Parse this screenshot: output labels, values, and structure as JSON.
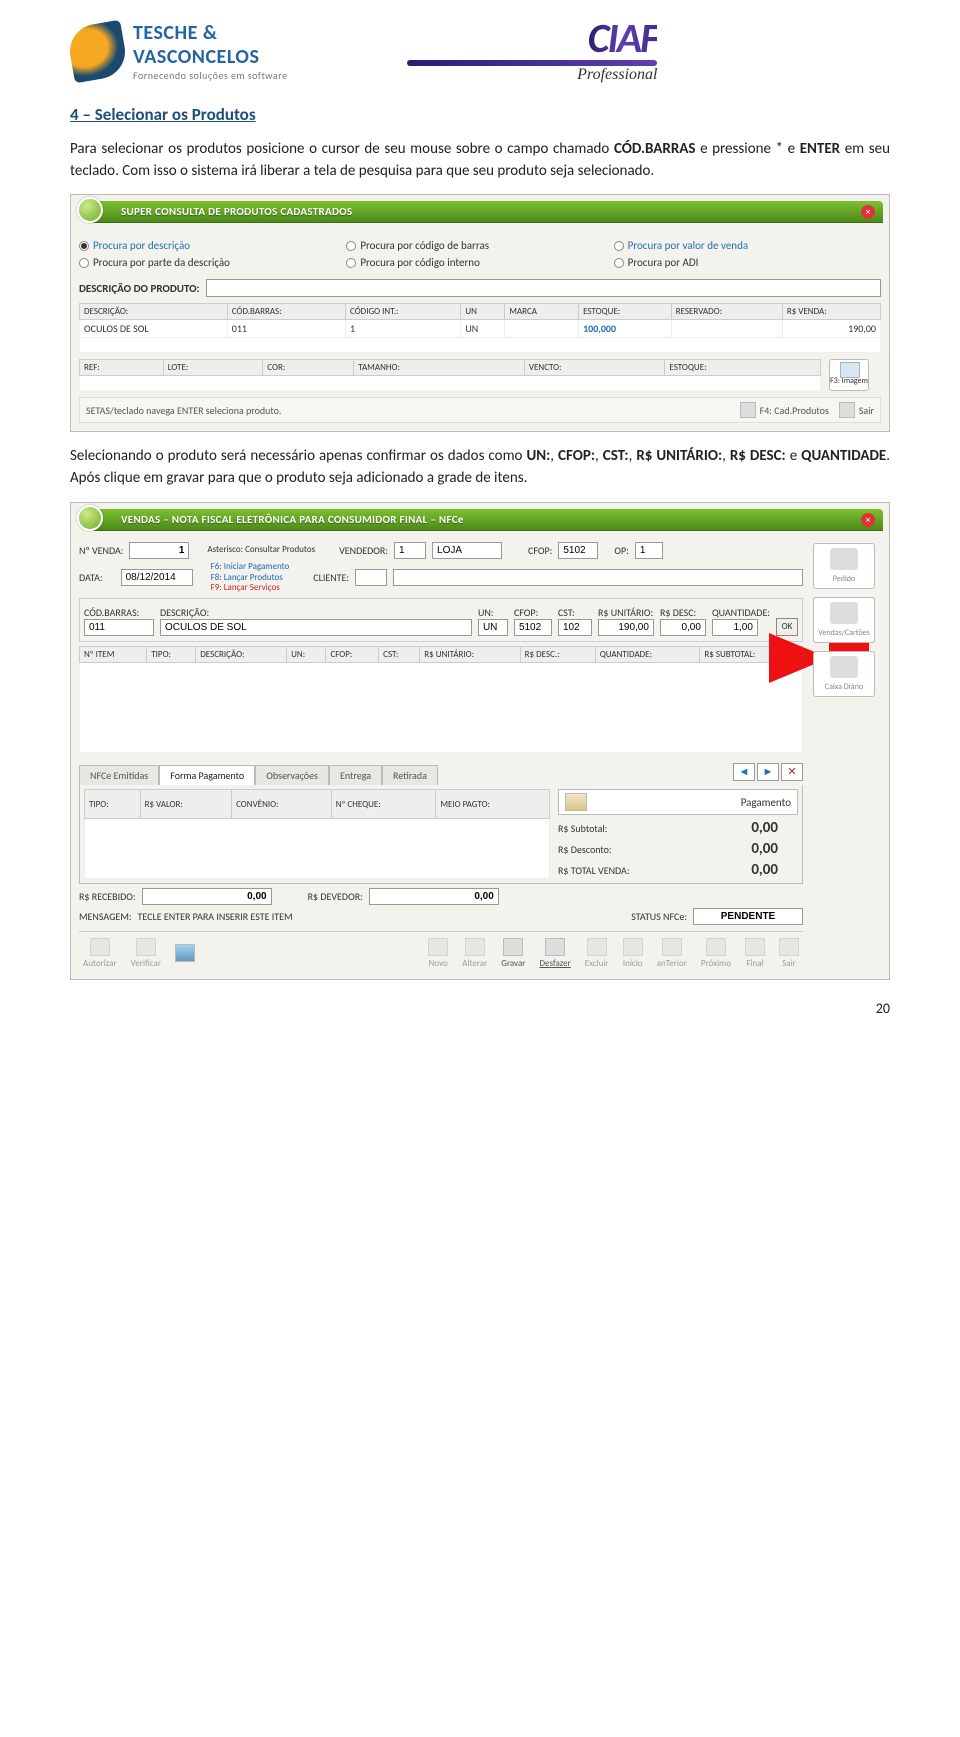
{
  "logos": {
    "tv_name": "TESCHE &",
    "tv_name2": "VASCONCELOS",
    "tv_tagline": "Fornecendo soluções em software",
    "ciaf": "CIAF",
    "ciaf_sub": "Professional"
  },
  "section_title": "4 – Selecionar os Produtos",
  "para1_a": "Para selecionar os produtos posicione o cursor de seu mouse sobre o campo chamado ",
  "para1_b": "CÓD.BARRAS",
  "para1_c": " e pressione * e ",
  "para1_d": "ENTER",
  "para1_e": " em seu teclado. Com isso o sistema irá liberar a tela de pesquisa para que seu produto seja selecionado.",
  "shot1": {
    "title": "SUPER CONSULTA DE PRODUTOS CADASTRADOS",
    "radios_col1": [
      "Procura por descrição",
      "Procura por parte da descrição"
    ],
    "radios_col2": [
      "Procura por código de barras",
      "Procura por código interno"
    ],
    "radios_col3": [
      "Procura por valor de venda",
      "Procura por ADI"
    ],
    "desc_label": "DESCRIÇÃO DO PRODUTO:",
    "headers": [
      "DESCRIÇÃO:",
      "CÓD.BARRAS:",
      "CÓDIGO INT.:",
      "UN",
      "MARCA",
      "ESTOQUE:",
      "RESERVADO:",
      "R$ VENDA:"
    ],
    "row": [
      "OCULOS DE SOL",
      "011",
      "1",
      "UN",
      "",
      "100,000",
      "",
      "190,00"
    ],
    "headers2": [
      "REF:",
      "LOTE:",
      "COR:",
      "TAMANHO:",
      "VENCTO:",
      "ESTOQUE:"
    ],
    "hint": "SETAS/teclado navega   ENTER seleciona produto.",
    "side_imagem": "F3: Imagem",
    "side_cad": "F4: Cad.Produtos",
    "side_sair": "Sair"
  },
  "para2_a": "Selecionando o produto será necessário apenas confirmar os dados como ",
  "para2_b": "UN:",
  "para2_c": ", ",
  "para2_d": "CFOP:",
  "para2_e": ", ",
  "para2_f": "CST:",
  "para2_g": ", ",
  "para2_h": "R$ UNITÁRIO:",
  "para2_i": ", ",
  "para2_j": "R$ DESC:",
  "para2_k": " e ",
  "para2_l": "QUANTIDADE",
  "para2_m": ". Após clique em gravar para que o produto seja adicionado a grade de itens.",
  "shot2": {
    "title": "VENDAS – NOTA FISCAL ELETRÔNICA PARA CONSUMIDOR FINAL – NFCe",
    "labels": {
      "n_venda": "Nº VENDA:",
      "n_venda_v": "1",
      "data": "DATA:",
      "data_v": "08/12/2014",
      "shortcuts_top": "Asterisco: Consultar Produtos",
      "shortcuts": [
        "F6: Iniciar Pagamento",
        "F8: Lançar Produtos",
        "F9: Lançar Serviços"
      ],
      "vendedor": "VENDEDOR:",
      "vendedor_v": "1",
      "loja": "LOJA",
      "cfop_top": "CFOP:",
      "cfop_top_v": "5102",
      "op": "OP:",
      "op_v": "1",
      "cliente": "CLIENTE:",
      "cod_barras": "CÓD.BARRAS:",
      "cod_barras_v": "011",
      "descricao": "DESCRIÇÃO:",
      "descricao_v": "OCULOS DE SOL",
      "un": "UN:",
      "un_v": "UN",
      "cfop": "CFOP:",
      "cfop_v": "5102",
      "cst": "CST:",
      "cst_v": "102",
      "unit": "R$ UNITÁRIO:",
      "unit_v": "190,00",
      "desc": "R$ DESC:",
      "desc_v": "0,00",
      "qtd": "QUANTIDADE:",
      "qtd_v": "1,00",
      "ok": "OK",
      "grid_headers": [
        "Nº ITEM",
        "TIPO:",
        "DESCRIÇÃO:",
        "UN:",
        "CFOP:",
        "CST:",
        "R$ UNITÁRIO:",
        "R$ DESC.:",
        "QUANTIDADE:",
        "R$ SUBTOTAL:"
      ]
    },
    "right_tiles": [
      "Pedido",
      "Vendas/Cartões",
      "Caixa Diário"
    ],
    "tabs": [
      "NFCe Emitidas",
      "Forma Pagamento",
      "Observações",
      "Entrega",
      "Retirada"
    ],
    "pay_headers": [
      "TIPO:",
      "R$ VALOR:",
      "CONVÊNIO:",
      "Nº CHEQUE:",
      "MEIO PAGTO:"
    ],
    "pagamento_label": "Pagamento",
    "subtotal_l": "R$ Subtotal:",
    "subtotal_v": "0,00",
    "desconto_l": "R$ Desconto:",
    "desconto_v": "0,00",
    "total_l": "R$ TOTAL VENDA:",
    "total_v": "0,00",
    "recebido_l": "R$ RECEBIDO:",
    "recebido_v": "0,00",
    "devedor_l": "R$ DEVEDOR:",
    "devedor_v": "0,00",
    "mensagem_l": "MENSAGEM:",
    "mensagem_v": "TECLE ENTER PARA INSERIR ESTE ITEM",
    "status_l": "STATUS NFCe:",
    "status_v": "PENDENTE",
    "tools": [
      "Autorizar",
      "Verificar",
      "",
      "Novo",
      "Alterar",
      "Gravar",
      "Desfazer",
      "Excluir",
      "Início",
      "anTerior",
      "Próximo",
      "Final",
      "Sair"
    ]
  },
  "page_number": "20"
}
